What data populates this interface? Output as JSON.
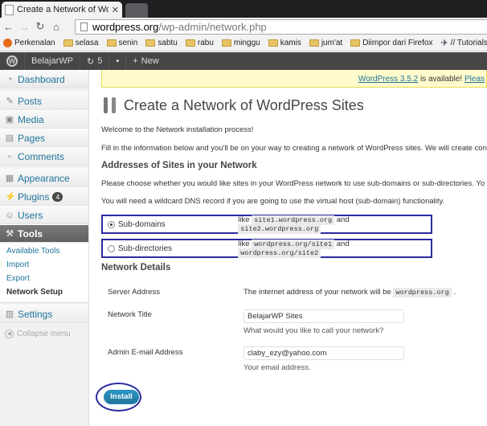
{
  "browser": {
    "tab_title": "Create a Network of Word",
    "url_host": "wordpress.org",
    "url_path": "/wp-admin/network.php",
    "bookmarks": [
      "Perkenalan",
      "selasa",
      "senin",
      "sabtu",
      "rabu",
      "minggu",
      "kamis",
      "jum'at",
      "Diimpor dari Firefox",
      "// Tutorials - Fre"
    ]
  },
  "adminbar": {
    "site": "BelajarWP",
    "updates": "5",
    "new_label": "New"
  },
  "sidebar": {
    "dashboard": "Dashboard",
    "posts": "Posts",
    "media": "Media",
    "pages": "Pages",
    "comments": "Comments",
    "appearance": "Appearance",
    "plugins": "Plugins",
    "plugins_badge": "4",
    "users": "Users",
    "tools": "Tools",
    "tools_sub": [
      "Available Tools",
      "Import",
      "Export",
      "Network Setup"
    ],
    "settings": "Settings",
    "collapse": "Collapse menu"
  },
  "content": {
    "update_link": "WordPress 3.5.2",
    "update_text": " is available! ",
    "update_link2": "Pleas",
    "title": "Create a Network of WordPress Sites",
    "welcome": "Welcome to the Network installation process!",
    "fill_in": "Fill in the information below and you'll be on your way to creating a network of WordPress sites. We will create confi",
    "addresses_heading": "Addresses of Sites in your Network",
    "choose": "Please choose whether you would like sites in your WordPress network to use sub-domains or sub-directories. Yo",
    "wildcard": "You will need a wildcard DNS record if you are going to use the virtual host (sub-domain) functionality.",
    "subdomains_label": "Sub-domains",
    "subdomains_like": "like",
    "subdomains_ex1": "site1.wordpress.org",
    "and": "and",
    "subdomains_ex2": "site2.wordpress.org",
    "subdirs_label": "Sub-directories",
    "subdirs_ex1": "wordpress.org/site1",
    "subdirs_ex2": "wordpress.org/site2",
    "details_heading": "Network Details",
    "server_label": "Server Address",
    "server_text": "The internet address of your network will be",
    "server_code": "wordpress.org",
    "server_dot": ".",
    "title_label": "Network Title",
    "title_value": "BelajarWP Sites",
    "title_hint": "What would you like to call your network?",
    "email_label": "Admin E-mail Address",
    "email_value": "claby_ezy@yahoo.com",
    "email_hint": "Your email address.",
    "install": "Install"
  }
}
